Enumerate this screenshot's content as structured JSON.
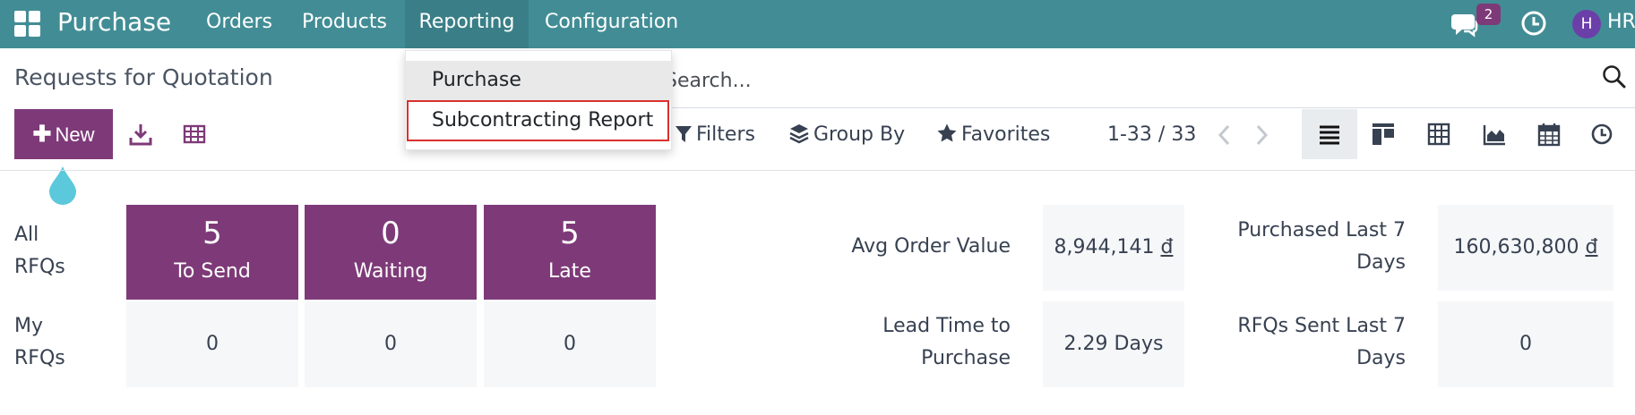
{
  "navbar": {
    "app_name": "Purchase",
    "menu": [
      "Orders",
      "Products",
      "Reporting",
      "Configuration"
    ],
    "messages_badge": "2",
    "avatar_letter": "H",
    "user_initials": "HR"
  },
  "reporting_dropdown": {
    "items": [
      "Purchase",
      "Subcontracting Report"
    ],
    "highlighted": "Subcontracting Report"
  },
  "control_panel": {
    "breadcrumb": "Requests for Quotation",
    "new_button": "New",
    "search_placeholder": "Search...",
    "filters": "Filters",
    "group_by": "Group By",
    "favorites": "Favorites",
    "pager": "1-33 / 33",
    "active_view": "list"
  },
  "dashboard": {
    "all_label": "All RFQs",
    "my_label": "My RFQs",
    "all_tiles": [
      {
        "value": "5",
        "label": "To Send"
      },
      {
        "value": "0",
        "label": "Waiting"
      },
      {
        "value": "5",
        "label": "Late"
      }
    ],
    "my_tiles": [
      "0",
      "0",
      "0"
    ],
    "stats": {
      "avg_order_value_label": "Avg Order Value",
      "avg_order_value_amount": "8,944,141",
      "purchased_label": "Purchased Last 7 Days",
      "purchased_amount": "160,630,800",
      "lead_time_label": "Lead Time to Purchase",
      "lead_time_value": "2.29 Days",
      "rfqs_sent_label": "RFQs Sent Last 7 Days",
      "rfqs_sent_value": "0",
      "currency": "đ"
    }
  },
  "colors": {
    "navbar": "#428d95",
    "primary": "#7e3a78",
    "highlight_border": "#d9302e",
    "tile_light": "#f6f7f9"
  }
}
